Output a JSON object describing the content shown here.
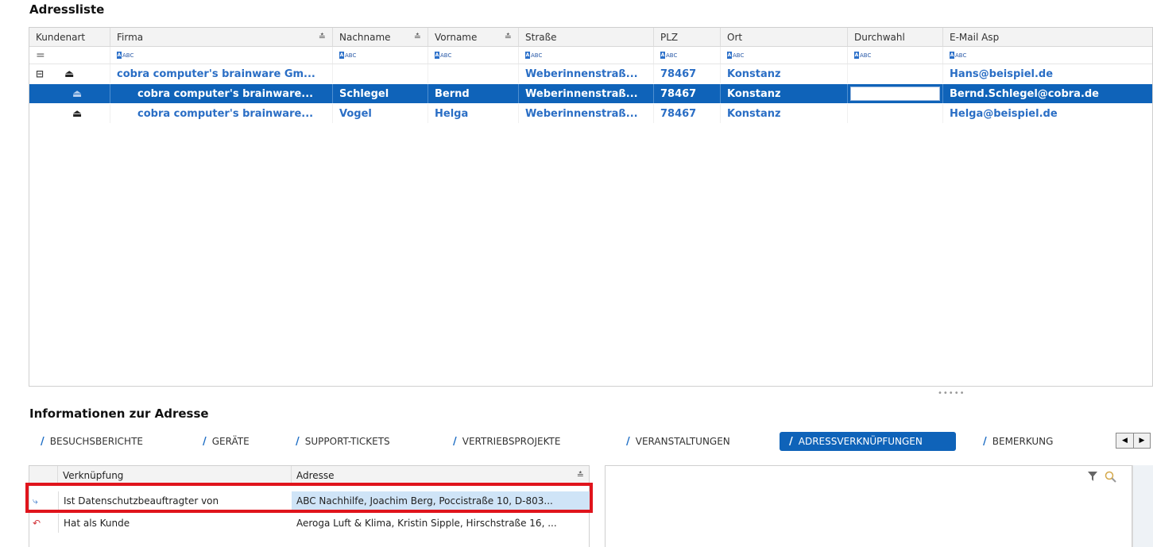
{
  "sections": {
    "address_list_title": "Adressliste",
    "info_title": "Informationen zur Adresse"
  },
  "address_grid": {
    "columns": [
      "Kundenart",
      "Firma",
      "Nachname",
      "Vorname",
      "Straße",
      "PLZ",
      "Ort",
      "Durchwahl",
      "E-Mail Asp"
    ],
    "filter_placeholder": "ABC",
    "rows": [
      {
        "firma": "cobra computer's brainware Gm...",
        "nachname": "",
        "vorname": "",
        "strasse": "Weberinnenstraß...",
        "plz": "78467",
        "ort": "Konstanz",
        "durchwahl": "",
        "email": "Hans@beispiel.de",
        "expanded": true,
        "selected": false
      },
      {
        "firma": "cobra computer's brainware...",
        "nachname": "Schlegel",
        "vorname": "Bernd",
        "strasse": "Weberinnenstraß...",
        "plz": "78467",
        "ort": "Konstanz",
        "durchwahl": "",
        "email": "Bernd.Schlegel@cobra.de",
        "expanded": false,
        "selected": true
      },
      {
        "firma": "cobra computer's brainware...",
        "nachname": "Vogel",
        "vorname": "Helga",
        "strasse": "Weberinnenstraß...",
        "plz": "78467",
        "ort": "Konstanz",
        "durchwahl": "",
        "email": "Helga@beispiel.de",
        "expanded": false,
        "selected": false
      }
    ]
  },
  "tabs": [
    {
      "label": "BESUCHSBERICHTE",
      "active": false
    },
    {
      "label": "GERÄTE",
      "active": false
    },
    {
      "label": "SUPPORT-TICKETS",
      "active": false
    },
    {
      "label": "VERTRIEBSPROJEKTE",
      "active": false
    },
    {
      "label": "VERANSTALTUNGEN",
      "active": false
    },
    {
      "label": "ADRESSVERKNÜPFUNGEN",
      "active": true
    },
    {
      "label": "BEMERKUNG",
      "active": false
    }
  ],
  "links_grid": {
    "columns": [
      "Verknüpfung",
      "Adresse"
    ],
    "rows": [
      {
        "type": "Ist Datenschutzbeauftragter von",
        "address": "ABC Nachhilfe, Joachim Berg, Poccistraße 10, D-803...",
        "icon": "link-forward-icon",
        "highlighted": true
      },
      {
        "type": "Hat als Kunde",
        "address": "Aeroga Luft & Klima, Kristin Sipple, Hirschstraße 16, ...",
        "icon": "link-back-icon",
        "highlighted": false
      }
    ]
  },
  "colors": {
    "accent": "#0f63b9",
    "link_text": "#2a6ec5",
    "highlight_box": "#e0141c"
  }
}
